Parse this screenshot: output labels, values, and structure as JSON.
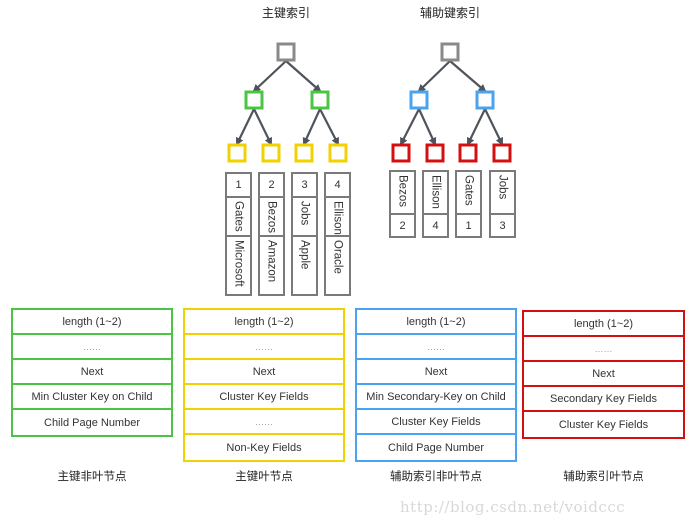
{
  "colors": {
    "root": "#8a8a8a",
    "primary_nonleaf": "#4cc443",
    "primary_leaf": "#f2d100",
    "secondary_nonleaf": "#4aa3f0",
    "secondary_leaf": "#d40f0f",
    "arrow": "#4f545c",
    "column_border": "#7a7a7a"
  },
  "primary_index": {
    "title": "主键索引",
    "rows": [
      {
        "id": "1",
        "name": "Gates",
        "company": "Microsoft"
      },
      {
        "id": "2",
        "name": "Bezos",
        "company": "Amazon"
      },
      {
        "id": "3",
        "name": "Jobs",
        "company": "Apple"
      },
      {
        "id": "4",
        "name": "Ellison",
        "company": "Oracle"
      }
    ]
  },
  "secondary_index": {
    "title": "辅助键索引",
    "rows": [
      {
        "name": "Bezos",
        "id": "2"
      },
      {
        "name": "Ellison",
        "id": "4"
      },
      {
        "name": "Gates",
        "id": "1"
      },
      {
        "name": "Jobs",
        "id": "3"
      }
    ]
  },
  "records": [
    {
      "caption": "主键非叶节点",
      "fields": [
        "length (1~2)",
        "……",
        "Next",
        "Min Cluster Key on Child",
        "Child Page Number"
      ]
    },
    {
      "caption": "主键叶节点",
      "fields": [
        "length (1~2)",
        "……",
        "Next",
        "Cluster Key Fields",
        "……",
        "Non-Key Fields"
      ]
    },
    {
      "caption": "辅助索引非叶节点",
      "fields": [
        "length (1~2)",
        "……",
        "Next",
        "Min Secondary-Key on Child",
        "Cluster Key Fields",
        "Child Page Number"
      ]
    },
    {
      "caption": "辅助索引叶节点",
      "fields": [
        "length (1~2)",
        "……",
        "Next",
        "Secondary Key Fields",
        "Cluster Key Fields"
      ]
    }
  ],
  "watermark": "http://blog.csdn.net/voidccc"
}
